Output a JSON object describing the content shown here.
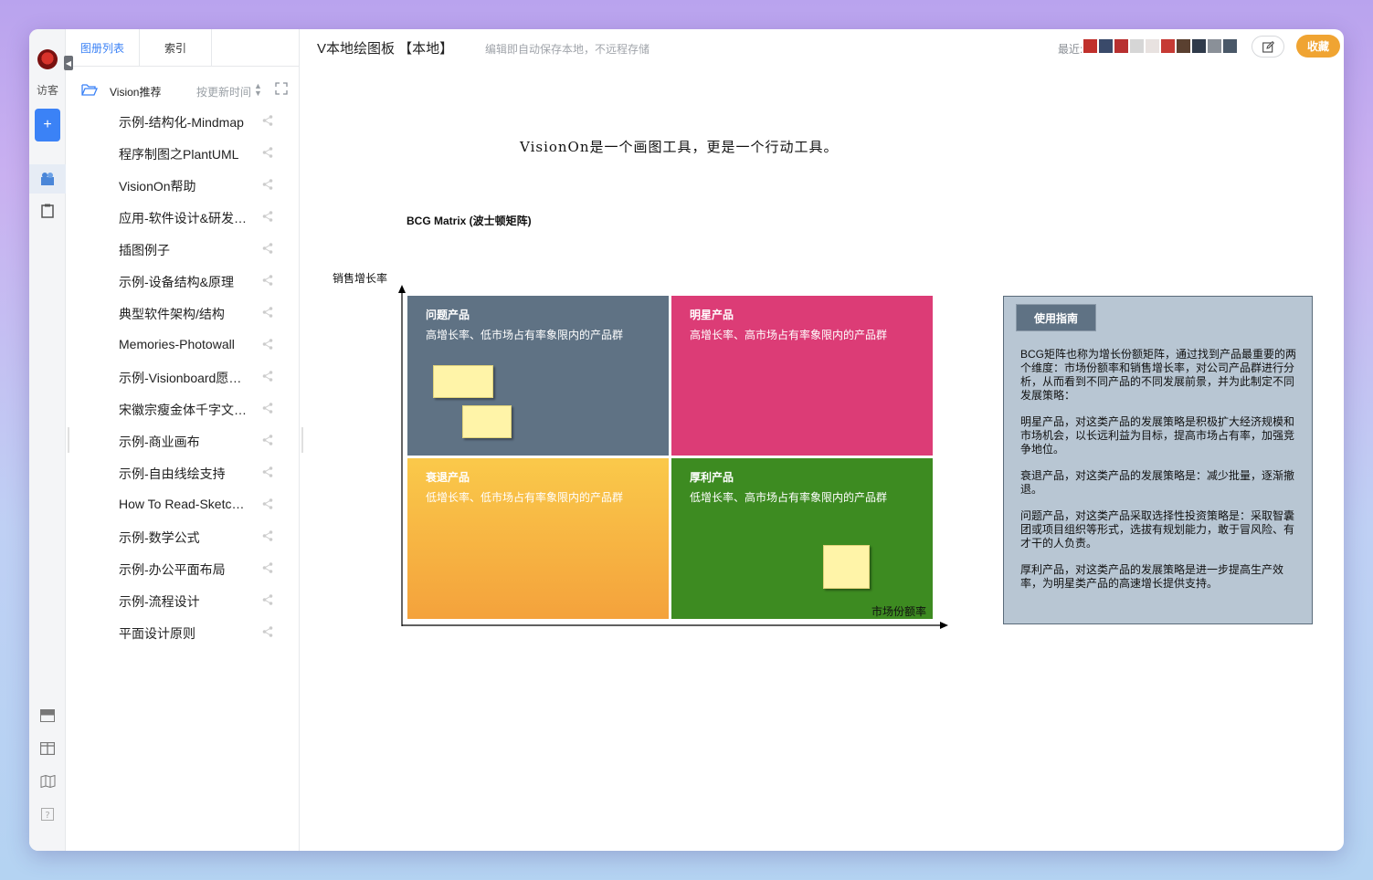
{
  "rail": {
    "user_label": "访客",
    "add_label": "+"
  },
  "sidebar": {
    "tabs": [
      "图册列表",
      "索引"
    ],
    "folder_name": "Vision推荐",
    "sort_label": "按更新时间",
    "items": [
      {
        "label": "示例-结构化-Mindmap"
      },
      {
        "label": "程序制图之PlantUML"
      },
      {
        "label": "VisionOn帮助"
      },
      {
        "label": "应用-软件设计&研发流程"
      },
      {
        "label": "插图例子"
      },
      {
        "label": "示例-设备结构&原理"
      },
      {
        "label": "典型软件架构/结构"
      },
      {
        "label": "Memories-Photowall"
      },
      {
        "label": "示例-Visionboard愿景板"
      },
      {
        "label": "宋徽宗瘦金体千字文临摹"
      },
      {
        "label": "示例-商业画布"
      },
      {
        "label": "示例-自由线绘支持"
      },
      {
        "label": "How To Read-Sketchnote"
      },
      {
        "label": "示例-数学公式"
      },
      {
        "label": "示例-办公平面布局"
      },
      {
        "label": "示例-流程设计"
      },
      {
        "label": "平面设计原则"
      }
    ]
  },
  "header": {
    "title": "V本地绘图板 【本地】",
    "subtitle": "编辑即自动保存本地，不远程存储",
    "recent_label": "最近:",
    "fav_label": "收藏"
  },
  "canvas": {
    "tagline": "VisionOn是一个画图工具，更是一个行动工具。",
    "bcg_title": "BCG Matrix (波士顿矩阵)",
    "y_axis_label": "销售增长率",
    "x_axis_label": "市场份额率",
    "quadrants": {
      "problem": {
        "title": "问题产品",
        "desc": "高增长率、低市场占有率象限内的产品群"
      },
      "star": {
        "title": "明星产品",
        "desc": "高增长率、高市场占有率象限内的产品群"
      },
      "decline": {
        "title": "衰退产品",
        "desc": "低增长率、低市场占有率象限内的产品群"
      },
      "profit": {
        "title": "厚利产品",
        "desc": "低增长率、高市场占有率象限内的产品群"
      }
    },
    "guide": {
      "button_label": "使用指南",
      "paragraphs": [
        "BCG矩阵也称为增长份额矩阵，通过找到产品最重要的两个维度：市场份额率和销售增长率，对公司产品群进行分析，从而看到不同产品的不同发展前景，并为此制定不同发展策略：",
        "明星产品，对这类产品的发展策略是积极扩大经济规模和市场机会，以长远利益为目标，提高市场占有率，加强竞争地位。",
        "衰退产品，对这类产品的发展策略是：减少批量，逐渐撤退。",
        "问题产品，对这类产品采取选择性投资策略是：采取智囊团或项目组织等形式，选拔有规划能力，敢于冒风险、有才干的人负责。",
        "厚利产品，对这类产品的发展策略是进一步提高生产效率，为明星类产品的高速增长提供支持。"
      ]
    }
  },
  "colors": {
    "accent": "#3b82f6",
    "favorite": "#f0a432",
    "problem": "#5f7284",
    "star": "#dc3c76",
    "decline": "#f6b540",
    "profit": "#3d8b21",
    "guide_bg": "#b8c6d3"
  }
}
